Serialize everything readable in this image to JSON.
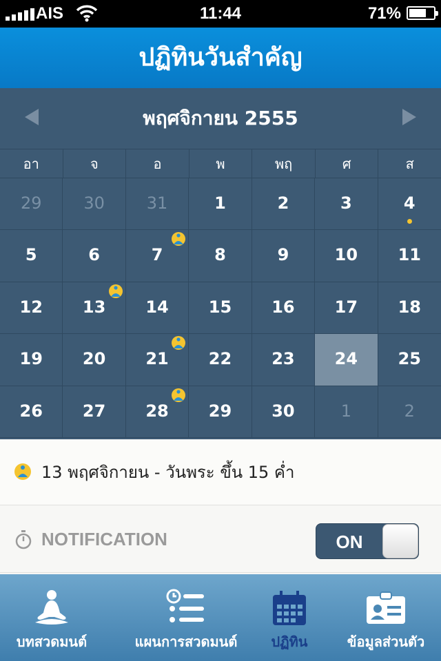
{
  "status_bar": {
    "carrier": "AIS",
    "time": "11:44",
    "battery_percent": "71%",
    "battery_level": 0.71
  },
  "header": {
    "title": "ปฏิทินวันสำคัญ"
  },
  "calendar": {
    "month_title": "พฤศจิกายน 2555",
    "weekdays": [
      "อา",
      "จ",
      "อ",
      "พ",
      "พฤ",
      "ศ",
      "ส"
    ],
    "days": [
      {
        "label": "29",
        "other": true
      },
      {
        "label": "30",
        "other": true
      },
      {
        "label": "31",
        "other": true
      },
      {
        "label": "1"
      },
      {
        "label": "2"
      },
      {
        "label": "3"
      },
      {
        "label": "4",
        "dot": true
      },
      {
        "label": "5"
      },
      {
        "label": "6"
      },
      {
        "label": "7",
        "monk": true
      },
      {
        "label": "8"
      },
      {
        "label": "9"
      },
      {
        "label": "10"
      },
      {
        "label": "11"
      },
      {
        "label": "12"
      },
      {
        "label": "13",
        "monk": true
      },
      {
        "label": "14"
      },
      {
        "label": "15"
      },
      {
        "label": "16"
      },
      {
        "label": "17"
      },
      {
        "label": "18"
      },
      {
        "label": "19"
      },
      {
        "label": "20"
      },
      {
        "label": "21",
        "monk": true
      },
      {
        "label": "22"
      },
      {
        "label": "23"
      },
      {
        "label": "24",
        "today": true
      },
      {
        "label": "25"
      },
      {
        "label": "26"
      },
      {
        "label": "27"
      },
      {
        "label": "28",
        "monk": true
      },
      {
        "label": "29"
      },
      {
        "label": "30"
      },
      {
        "label": "1",
        "other": true
      },
      {
        "label": "2",
        "other": true
      }
    ]
  },
  "event": {
    "text": "13 พฤศจิกายน - วันพระ ขึ้น 15 ค่ำ"
  },
  "notification": {
    "label": "NOTIFICATION",
    "toggle_label": "ON",
    "enabled": true
  },
  "tabbar": {
    "tabs": [
      {
        "label": "บทสวดมนต์",
        "icon": "meditation-icon"
      },
      {
        "label": "แผนการสวดมนต์",
        "icon": "plan-list-icon"
      },
      {
        "label": "ปฏิทิน",
        "icon": "calendar-icon",
        "active": true
      },
      {
        "label": "ข้อมูลส่วนตัว",
        "icon": "profile-card-icon"
      }
    ]
  },
  "colors": {
    "header_blue": "#0a8fdc",
    "calendar_bg": "#3d5a74",
    "today_bg": "#7a90a3",
    "dot_yellow": "#f4c430",
    "active_tab": "#1a3f8a"
  }
}
